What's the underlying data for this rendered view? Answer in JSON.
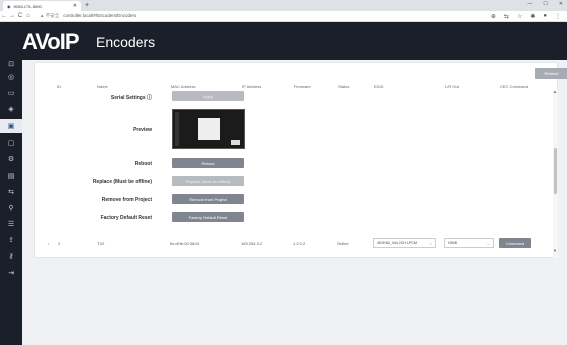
{
  "browser": {
    "tab_title": "HDM-CTL-5000",
    "tab_close": "✕",
    "new_tab": "+",
    "win_min": "—",
    "win_max": "☐",
    "win_close": "✕",
    "back": "←",
    "forward": "→",
    "reload": "C",
    "home": "⌂",
    "not_secure": "▲ 不安全",
    "url": "controller.local/#/Encoders/Encoders",
    "ext_icons": [
      "⊕",
      "⇆",
      "☆",
      "✱",
      "●",
      "⋮"
    ]
  },
  "app": {
    "logo": "AVoIP",
    "page_title": "Encoders"
  },
  "sidebar": {
    "icons": [
      "⊡",
      "◎",
      "▭",
      "◈",
      "▣",
      "▢",
      "⚙",
      "▤",
      "⇆",
      "⚲",
      "☰",
      "⇪",
      "⚷",
      "⇥"
    ],
    "active_index": 4
  },
  "toolbar": {
    "refresh": "Refresh"
  },
  "table": {
    "headers": {
      "id": "ID",
      "name": "Name",
      "mac": "MAC Address",
      "ip": "IP Address",
      "firmware": "Firmware",
      "status": "Status",
      "edid": "EDID",
      "lr_out": "L/R Out",
      "cec": "CEC Command"
    }
  },
  "detail": {
    "serial_label": "Serial Settings ⓘ",
    "serial_button": "Apply",
    "preview_label": "Preview",
    "reboot_label": "Reboot",
    "reboot_button": "Reboot",
    "replace_label": "Replace (Must be offline)",
    "replace_button": "Replace (Must be offline)",
    "remove_label": "Remove from Project",
    "remove_button": "Remove from Project",
    "reset_label": "Factory Default Reset",
    "reset_button": "Factory Default Reset"
  },
  "row2": {
    "expand": "›",
    "id": "2",
    "name": "TX2",
    "mac": "6c:df:fb:00:38:6f",
    "ip": "169.254.3.2",
    "firmware": "1.2.0.2",
    "status": "Online",
    "edid": "4K2K60_444 2CH LPCM",
    "lr_out": "HDMI",
    "cec_button": "Command"
  },
  "scrollbar": {
    "up": "▲",
    "down": "▼"
  }
}
